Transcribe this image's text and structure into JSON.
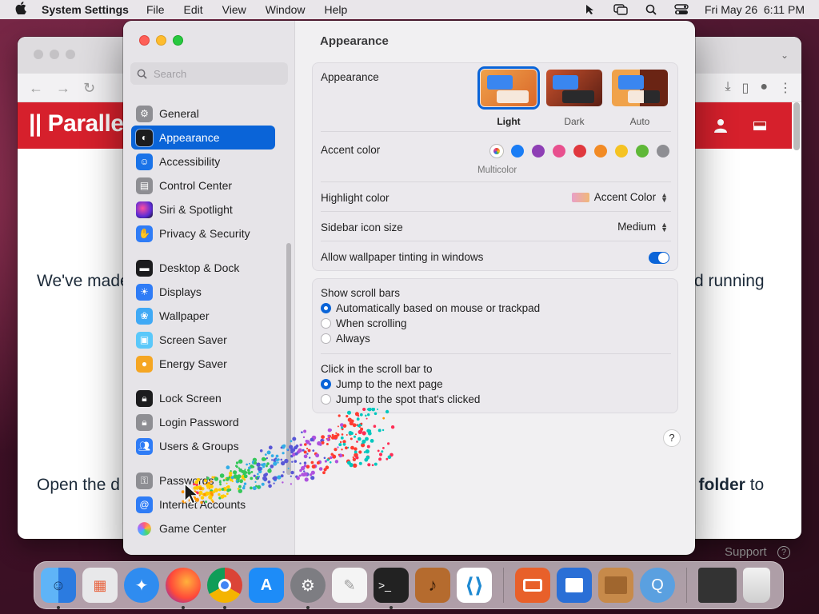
{
  "menubar": {
    "app_name": "System Settings",
    "menus": [
      "File",
      "Edit",
      "View",
      "Window",
      "Help"
    ],
    "clock": "Fri May 26  6:11 PM"
  },
  "browser": {
    "logo": "|| Paralle",
    "text_left1": "We've made",
    "text_right1": "d running",
    "text_left2": "Open the d",
    "text_right2_bold": "s folder",
    "text_right2_rest": " to",
    "support": "Support"
  },
  "sidebar": {
    "search_placeholder": "Search",
    "items": [
      {
        "label": "General",
        "icon": "gear-icon",
        "color": "#8e8e93",
        "group": 1
      },
      {
        "label": "Appearance",
        "icon": "appearance-icon",
        "color": "#1c1c1e",
        "group": 1,
        "active": true
      },
      {
        "label": "Accessibility",
        "icon": "accessibility-icon",
        "color": "#1a73e8",
        "group": 1
      },
      {
        "label": "Control Center",
        "icon": "control-center-icon",
        "color": "#8e8e93",
        "group": 1
      },
      {
        "label": "Siri & Spotlight",
        "icon": "siri-icon",
        "color": "#7b2cbf",
        "group": 1
      },
      {
        "label": "Privacy & Security",
        "icon": "hand-icon",
        "color": "#2f7cf6",
        "group": 1
      },
      {
        "label": "Desktop & Dock",
        "icon": "dock-icon",
        "color": "#1c1c1e",
        "group": 2
      },
      {
        "label": "Displays",
        "icon": "sun-icon",
        "color": "#2f7cf6",
        "group": 2
      },
      {
        "label": "Wallpaper",
        "icon": "flower-icon",
        "color": "#3fa9f5",
        "group": 2
      },
      {
        "label": "Screen Saver",
        "icon": "screen-saver-icon",
        "color": "#5ac8fa",
        "group": 2
      },
      {
        "label": "Energy Saver",
        "icon": "bulb-icon",
        "color": "#f5a623",
        "group": 2
      },
      {
        "label": "Lock Screen",
        "icon": "lock-icon",
        "color": "#1c1c1e",
        "group": 3
      },
      {
        "label": "Login Password",
        "icon": "lock-icon",
        "color": "#8e8e93",
        "group": 3
      },
      {
        "label": "Users & Groups",
        "icon": "users-icon",
        "color": "#2f7cf6",
        "group": 3
      },
      {
        "label": "Passwords",
        "icon": "key-icon",
        "color": "#8e8e93",
        "group": 4
      },
      {
        "label": "Internet Accounts",
        "icon": "at-icon",
        "color": "#2f7cf6",
        "group": 4
      },
      {
        "label": "Game Center",
        "icon": "game-center-icon",
        "color": "#ffffff",
        "group": 4
      }
    ]
  },
  "content": {
    "title": "Appearance",
    "appearance_label": "Appearance",
    "modes": [
      {
        "label": "Light",
        "selected": true
      },
      {
        "label": "Dark",
        "selected": false
      },
      {
        "label": "Auto",
        "selected": false
      }
    ],
    "accent_label": "Accent color",
    "accent_colors": [
      "multicolor",
      "#1a7df5",
      "#8e3fb5",
      "#e8508e",
      "#e0383e",
      "#f28b25",
      "#f5c323",
      "#5fb838",
      "#8e8e93"
    ],
    "accent_caption": "Multicolor",
    "highlight_label": "Highlight color",
    "highlight_value": "Accent Color",
    "icon_size_label": "Sidebar icon size",
    "icon_size_value": "Medium",
    "tinting_label": "Allow wallpaper tinting in windows",
    "tinting_on": true,
    "scroll_label": "Show scroll bars",
    "scroll_options": [
      {
        "label": "Automatically based on mouse or trackpad",
        "checked": true
      },
      {
        "label": "When scrolling",
        "checked": false
      },
      {
        "label": "Always",
        "checked": false
      }
    ],
    "click_label": "Click in the scroll bar to",
    "click_options": [
      {
        "label": "Jump to the next page",
        "checked": true
      },
      {
        "label": "Jump to the spot that's clicked",
        "checked": false
      }
    ],
    "help": "?"
  },
  "dock": {
    "apps": [
      {
        "name": "finder",
        "color": "#3a8ef0",
        "running": true
      },
      {
        "name": "launchpad",
        "color": "#e8e8ea",
        "running": false
      },
      {
        "name": "safari",
        "color": "#2f8cf0",
        "running": false
      },
      {
        "name": "firefox",
        "color": "#ff7a1a",
        "running": true
      },
      {
        "name": "chrome",
        "color": "#ffffff",
        "running": true
      },
      {
        "name": "app-store",
        "color": "#1d8cf8",
        "running": false
      },
      {
        "name": "system-settings",
        "color": "#7d7d82",
        "running": true
      },
      {
        "name": "textedit",
        "color": "#f4f4f4",
        "running": false
      },
      {
        "name": "terminal",
        "color": "#222222",
        "running": true
      },
      {
        "name": "instruments",
        "color": "#b56b2e",
        "running": false
      },
      {
        "name": "vscode",
        "color": "#ffffff",
        "running": false
      },
      {
        "name": "parallels-desktop",
        "color": "#e8602a",
        "running": false
      },
      {
        "name": "parallels-toolbox",
        "color": "#2a6fd6",
        "running": false
      },
      {
        "name": "archive-utility",
        "color": "#c78a4a",
        "running": false
      },
      {
        "name": "quicktime",
        "color": "#5aa0e0",
        "running": false
      },
      {
        "name": "downloads-stack",
        "color": "#333333",
        "running": false
      },
      {
        "name": "trash",
        "color": "#dadada",
        "running": false
      }
    ]
  }
}
